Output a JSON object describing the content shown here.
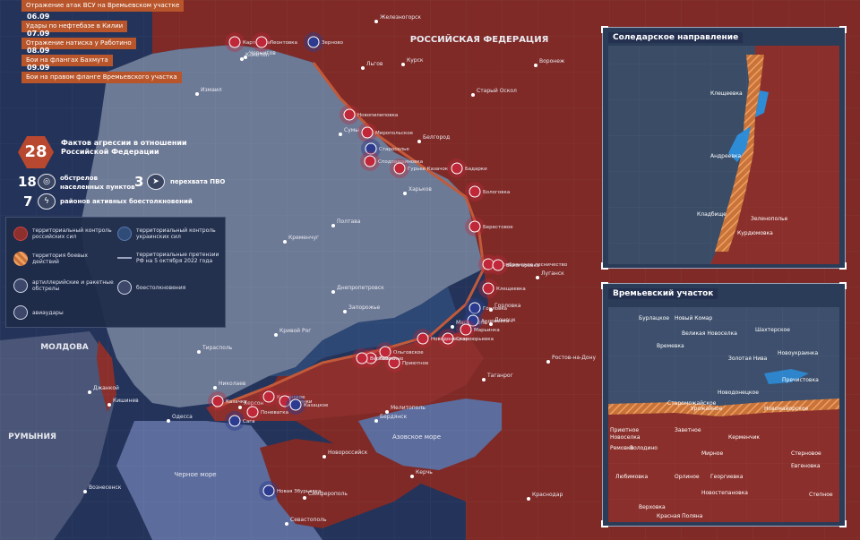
{
  "news": [
    {
      "date": "",
      "title": "Отражение атак ВСУ на Времьевском участке"
    },
    {
      "date": "06.09",
      "title": "Удары по нефтебазе в Килии"
    },
    {
      "date": "07.09",
      "title": "Отражение натиска у Работино"
    },
    {
      "date": "08.09",
      "title": "Бои на флангах Бахмута"
    },
    {
      "date": "09.09",
      "title": "Бои на правом фланге Времьевского участка"
    }
  ],
  "stats": {
    "aggression_count": "28",
    "aggression_label": "Фактов агрессии в отношении Российской Федерации",
    "shelling_count": "18",
    "shelling_label": "обстрелов населенных пунктов",
    "intercept_count": "3",
    "intercept_label": "перехвата ПВО",
    "clash_count": "7",
    "clash_label": "районов активных боестолкновений"
  },
  "legend": {
    "russian_control": "территориальный контроль российских сил",
    "ukrainian_control": "территориальный контроль украинских сил",
    "combat_zone": "территория боевых действий",
    "territorial_claims": "территориальные претензии РФ на 5 октября 2022 года",
    "artillery": "артиллерийские и ракетные обстрелы",
    "clashes": "боестолкновения",
    "airstrikes": "авиаудары"
  },
  "colors": {
    "russian": "#7f2a27",
    "ukrainian": "#2a3f6a",
    "sea": "#5a6b9a",
    "accent_orange": "#e07b39",
    "marker_red": "#c0283a",
    "marker_blue": "#2c3b8f"
  },
  "map_labels": {
    "russia": "РОССИЙСКАЯ ФЕДЕРАЦИЯ",
    "moldova": "МОЛДОВА",
    "romania": "РУМЫНИЯ",
    "black_sea": "Черное море",
    "azov_sea": "Азовское море",
    "cities": [
      "Железногорск",
      "Курск",
      "Льгов",
      "Воронеж",
      "Старый Оскол",
      "Белгород",
      "Сумы",
      "Харьков",
      "Полтава",
      "Кременчуг",
      "Днепропетровск",
      "Кривой Рог",
      "Запорожье",
      "Николаев",
      "Одесса",
      "Херсон",
      "Донецк",
      "Горловка",
      "Луганск",
      "Ростов-на-Дону",
      "Таганрог",
      "Мариуполь",
      "Бердянск",
      "Мелитополь",
      "Симферополь",
      "Севастополь",
      "Керчь",
      "Краснодар",
      "Новороссийск",
      "Джанкой",
      "Кишинев",
      "Тирасполь",
      "Вознесенск",
      "Измаил",
      "Чернигов",
      "Конотоп"
    ],
    "markers": [
      "Карповичи",
      "Леонтовка",
      "Зерново",
      "Новопилиповка",
      "Миропольское",
      "Старосолье",
      "Сподовашиновка",
      "Гурьев Казачок",
      "Бадарки",
      "Бологовка",
      "Берестовое",
      "Серебрянское лесничество",
      "Белогоровка",
      "Клещеевка",
      "Горловка",
      "Андреевка",
      "Марьинка",
      "Староюрьевка",
      "Новодонецкое",
      "Ольговское",
      "Приютное",
      "Работино",
      "Вербовое",
      "Каменское",
      "Кринки",
      "Казацкое",
      "Казачка",
      "Поневатка",
      "Сага",
      "Новая Збурьевка"
    ]
  },
  "inset_soledar": {
    "title": "Соледарское направление",
    "labels": [
      "Клещеевка",
      "Андреевка",
      "Кладбище",
      "Зеленополье",
      "Курдюмовка"
    ]
  },
  "inset_vremevka": {
    "title": "Времьевский участок",
    "labels": [
      "Бурлацкое",
      "Новый Комар",
      "Шахтерское",
      "Великая Новоселка",
      "Времевка",
      "Новоукраинка",
      "Золотая Нива",
      "Пречистовка",
      "Новодонецкое",
      "Урожайное",
      "Староможайское",
      "Новомайорское",
      "Приютное",
      "Заветное",
      "Новоселка",
      "Керменчик",
      "Ремовка",
      "Володино",
      "Мирное",
      "Стерновое",
      "Евгеновка",
      "Любимовка",
      "Орлиное",
      "Георгиевка",
      "Новостепановка",
      "Степное",
      "Верховка",
      "Красная Поляна"
    ]
  }
}
